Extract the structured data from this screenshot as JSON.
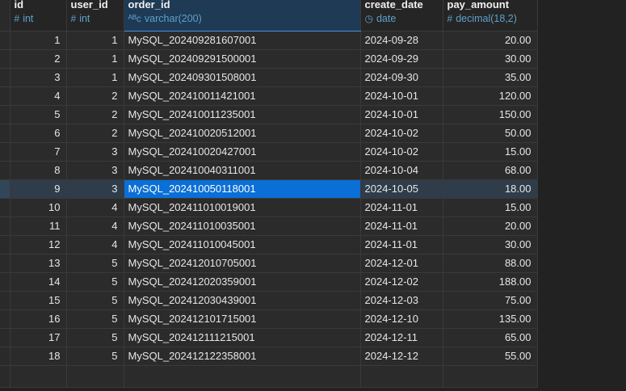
{
  "columns": [
    {
      "name": "id",
      "icon": "hash-icon",
      "icon_glyph": "#",
      "type": "int"
    },
    {
      "name": "user_id",
      "icon": "hash-icon",
      "icon_glyph": "#",
      "type": "int"
    },
    {
      "name": "order_id",
      "icon": "text-type-icon",
      "icon_glyph": "ᴬᴮc",
      "type": "varchar(200)"
    },
    {
      "name": "create_date",
      "icon": "clock-icon",
      "icon_glyph": "◷",
      "type": "date"
    },
    {
      "name": "pay_amount",
      "icon": "hash-icon",
      "icon_glyph": "#",
      "type": "decimal(18,2)"
    }
  ],
  "rows": [
    [
      "1",
      "1",
      "MySQL_202409281607001",
      "2024-09-28",
      "20.00"
    ],
    [
      "2",
      "1",
      "MySQL_202409291500001",
      "2024-09-29",
      "30.00"
    ],
    [
      "3",
      "1",
      "MySQL_202409301508001",
      "2024-09-30",
      "35.00"
    ],
    [
      "4",
      "2",
      "MySQL_202410011421001",
      "2024-10-01",
      "120.00"
    ],
    [
      "5",
      "2",
      "MySQL_202410011235001",
      "2024-10-01",
      "150.00"
    ],
    [
      "6",
      "2",
      "MySQL_202410020512001",
      "2024-10-02",
      "50.00"
    ],
    [
      "7",
      "3",
      "MySQL_202410020427001",
      "2024-10-02",
      "15.00"
    ],
    [
      "8",
      "3",
      "MySQL_202410040311001",
      "2024-10-04",
      "68.00"
    ],
    [
      "9",
      "3",
      "MySQL_202410050118001",
      "2024-10-05",
      "18.00"
    ],
    [
      "10",
      "4",
      "MySQL_202411010019001",
      "2024-11-01",
      "15.00"
    ],
    [
      "11",
      "4",
      "MySQL_202411010035001",
      "2024-11-01",
      "20.00"
    ],
    [
      "12",
      "4",
      "MySQL_202411010045001",
      "2024-11-01",
      "30.00"
    ],
    [
      "13",
      "5",
      "MySQL_202412010705001",
      "2024-12-01",
      "88.00"
    ],
    [
      "14",
      "5",
      "MySQL_202412020359001",
      "2024-12-02",
      "188.00"
    ],
    [
      "15",
      "5",
      "MySQL_202412030439001",
      "2024-12-03",
      "75.00"
    ],
    [
      "16",
      "5",
      "MySQL_202412101715001",
      "2024-12-10",
      "135.00"
    ],
    [
      "17",
      "5",
      "MySQL_202412111215001",
      "2024-12-11",
      "65.00"
    ],
    [
      "18",
      "5",
      "MySQL_202412122358001",
      "2024-12-12",
      "55.00"
    ]
  ],
  "selected_row_index": 8,
  "selected_column_index": 2,
  "colors": {
    "background": "#222222",
    "selection": "#0a6fd6",
    "type_text": "#5fa0c8"
  }
}
